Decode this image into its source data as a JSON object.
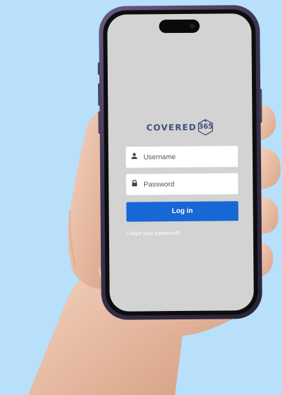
{
  "logo": {
    "brand_text": "COVERED",
    "badge_number": "365",
    "color": "#3f4f7c"
  },
  "login_form": {
    "username": {
      "placeholder": "Username",
      "value": "",
      "icon": "user-icon"
    },
    "password": {
      "placeholder": "Password",
      "value": "",
      "icon": "lock-icon"
    },
    "submit_label": "Log in",
    "forgot_link": "Forgot your password?"
  },
  "colors": {
    "background": "#b8e0fb",
    "screen": "#d3d3d3",
    "primary_button": "#1867d6",
    "field": "#ffffff"
  }
}
